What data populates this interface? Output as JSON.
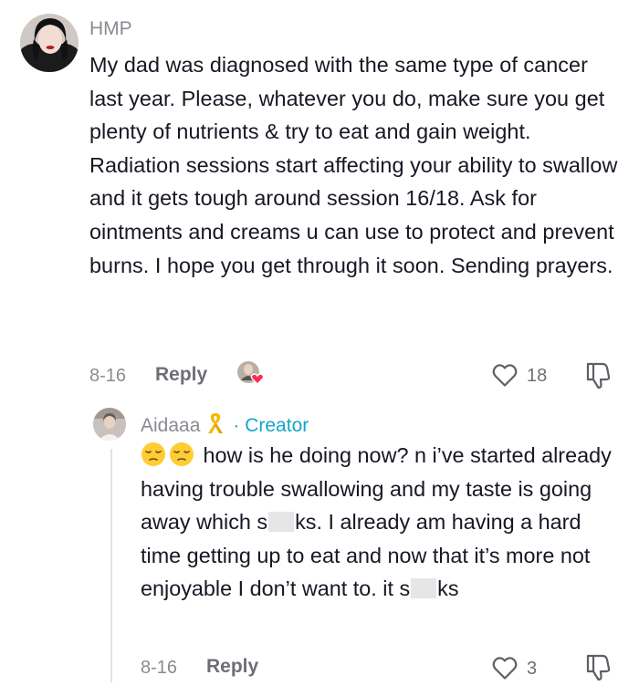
{
  "comment": {
    "username": "HMP",
    "text": "My dad was diagnosed with the same type of cancer last year. Please, whatever you do, make sure you get plenty of nutrients & try to eat and gain weight. Radiation sessions start affecting your ability to swallow and it gets tough around session 16/18. Ask for ointments and creams u can use to protect and prevent burns. I hope you get through it soon. Sending prayers.",
    "date": "8-16",
    "reply_label": "Reply",
    "like_count": "18"
  },
  "reply": {
    "username": "Aidaaa",
    "creator_label": "· Creator",
    "text_part1": "how is he doing now? n i’ve started already having trouble swallowing and my taste is going away which s",
    "text_part2": "ks. I already am having a hard time getting up to eat and now that it’s more not enjoyable I don’t want to. it s",
    "text_part3": "ks",
    "date": "8-16",
    "reply_label": "Reply",
    "like_count": "3"
  },
  "colors": {
    "secondary_text": "#8a8b91",
    "creator": "#12a6c9",
    "heart_badge": "#fe2c55"
  },
  "icons": [
    "avatar-hmp",
    "avatar-aidaaa",
    "heart-outline-icon",
    "dislike-icon",
    "ribbon-icon",
    "pensive-face-emoji",
    "creator-liked-heart-icon"
  ]
}
